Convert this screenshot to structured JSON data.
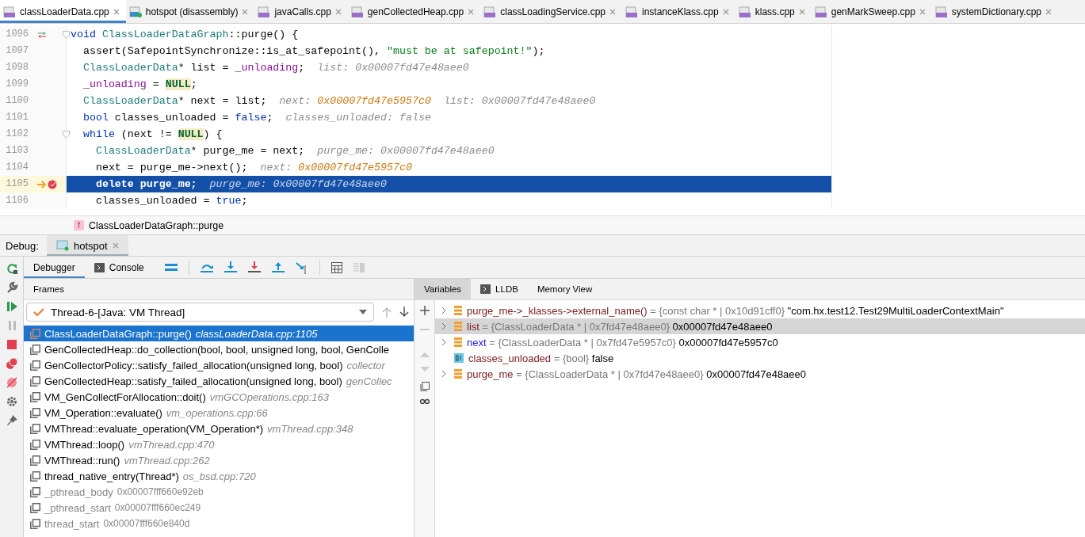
{
  "tabs": [
    {
      "label": "classLoaderData.cpp",
      "kind": "cpp",
      "selected": true
    },
    {
      "label": "hotspot (disassembly)",
      "kind": "disasm",
      "selected": false
    },
    {
      "label": "javaCalls.cpp",
      "kind": "cpp",
      "selected": false
    },
    {
      "label": "genCollectedHeap.cpp",
      "kind": "cpp",
      "selected": false
    },
    {
      "label": "classLoadingService.cpp",
      "kind": "cpp",
      "selected": false
    },
    {
      "label": "instanceKlass.cpp",
      "kind": "cpp",
      "selected": false
    },
    {
      "label": "klass.cpp",
      "kind": "cpp",
      "selected": false
    },
    {
      "label": "genMarkSweep.cpp",
      "kind": "cpp",
      "selected": false
    },
    {
      "label": "systemDictionary.cpp",
      "kind": "cpp",
      "selected": false
    }
  ],
  "editor": {
    "lines": [
      {
        "number": "1096",
        "kind": "override",
        "current": false,
        "foldable": true,
        "tokens": [
          {
            "t": "void ",
            "kind": "kw"
          },
          {
            "t": "ClassLoaderDataGraph",
            "kind": "type"
          },
          {
            "t": "::purge() {"
          }
        ]
      },
      {
        "number": "1097",
        "kind": "plain",
        "current": false,
        "foldable": false,
        "tokens": [
          {
            "t": "  assert(SafepointSynchronize::is_at_safepoint(), "
          },
          {
            "t": "\"must be at safepoint!\"",
            "kind": "str"
          },
          {
            "t": ");"
          }
        ]
      },
      {
        "number": "1098",
        "kind": "plain",
        "current": false,
        "foldable": false,
        "tokens": [
          {
            "t": "  ClassLoaderData",
            "kind": "type"
          },
          {
            "t": "* list = "
          },
          {
            "t": "_unloading",
            "kind": "glob"
          },
          {
            "t": ";"
          }
        ],
        "hints": [
          {
            "name": "list: ",
            "value": "0x00007fd47e48aee0",
            "changed": false
          }
        ]
      },
      {
        "number": "1099",
        "kind": "plain",
        "current": false,
        "foldable": false,
        "tokens": [
          {
            "t": "  _unloading",
            "kind": "glob"
          },
          {
            "t": " = "
          },
          {
            "t": "NULL",
            "kind": "macro"
          },
          {
            "t": ";"
          }
        ]
      },
      {
        "number": "1100",
        "kind": "plain",
        "current": false,
        "foldable": false,
        "tokens": [
          {
            "t": "  ClassLoaderData",
            "kind": "type"
          },
          {
            "t": "* next = list;"
          }
        ],
        "hints": [
          {
            "name": "next: ",
            "value": "0x00007fd47e5957c0",
            "changed": true
          },
          {
            "name": "list: ",
            "value": "0x00007fd47e48aee0",
            "changed": false
          }
        ]
      },
      {
        "number": "1101",
        "kind": "plain",
        "current": false,
        "foldable": false,
        "tokens": [
          {
            "t": "  bool",
            "kind": "kw"
          },
          {
            "t": " classes_unloaded = "
          },
          {
            "t": "false",
            "kind": "kw"
          },
          {
            "t": ";"
          }
        ],
        "hints": [
          {
            "name": "classes_unloaded: ",
            "value": "false",
            "changed": false
          }
        ]
      },
      {
        "number": "1102",
        "kind": "plain",
        "current": false,
        "foldable": true,
        "tokens": [
          {
            "t": "  while",
            "kind": "kw"
          },
          {
            "t": " (next != "
          },
          {
            "t": "NULL",
            "kind": "macro"
          },
          {
            "t": ") {"
          }
        ]
      },
      {
        "number": "1103",
        "kind": "plain",
        "current": false,
        "foldable": false,
        "tokens": [
          {
            "t": "    ClassLoaderData",
            "kind": "type"
          },
          {
            "t": "* purge_me = next;"
          }
        ],
        "hints": [
          {
            "name": "purge_me: ",
            "value": "0x00007fd47e48aee0",
            "changed": false
          }
        ]
      },
      {
        "number": "1104",
        "kind": "plain",
        "current": false,
        "foldable": false,
        "tokens": [
          {
            "t": "    next = purge_me->next();"
          }
        ],
        "hints": [
          {
            "name": "next: ",
            "value": "0x00007fd47e5957c0",
            "changed": true
          }
        ]
      },
      {
        "number": "1105",
        "kind": "breakpoint",
        "current": true,
        "foldable": false,
        "tokens": [
          {
            "t": "    delete",
            "kind": "kw"
          },
          {
            "t": " purge_me;"
          }
        ],
        "hints": [
          {
            "name": "purge_me: ",
            "value": "0x00007fd47e48aee0",
            "changed": false
          }
        ]
      },
      {
        "number": "1106",
        "kind": "plain",
        "current": false,
        "foldable": false,
        "tokens": [
          {
            "t": "    classes_unloaded = "
          },
          {
            "t": "true",
            "kind": "kw"
          },
          {
            "t": ";"
          }
        ]
      }
    ],
    "breadcrumb": {
      "badge": "f",
      "text": "ClassLoaderDataGraph::purge"
    }
  },
  "debug": {
    "label": "Debug:",
    "session_tab": {
      "label": "hotspot",
      "selected": true
    },
    "tabs": [
      {
        "label": "Debugger",
        "kind": "plain",
        "selected": true
      },
      {
        "label": "Console",
        "kind": "console",
        "selected": false
      }
    ],
    "frames": {
      "title": "Frames",
      "thread": "Thread-6-[Java: VM Thread]",
      "items": [
        {
          "function": "ClassLoaderDataGraph::purge()",
          "location": "classLoaderData.cpp:1105",
          "kind": "source",
          "selected": true
        },
        {
          "function": "GenCollectedHeap::do_collection(bool, bool, unsigned long, bool, GenColle",
          "kind": "source",
          "selected": false
        },
        {
          "function": "GenCollectorPolicy::satisfy_failed_allocation(unsigned long, bool)",
          "location": "collector",
          "kind": "source",
          "selected": false
        },
        {
          "function": "GenCollectedHeap::satisfy_failed_allocation(unsigned long, bool)",
          "location": "genCollec",
          "kind": "source",
          "selected": false
        },
        {
          "function": "VM_GenCollectForAllocation::doit()",
          "location": "vmGCOperations.cpp:163",
          "kind": "source",
          "selected": false
        },
        {
          "function": "VM_Operation::evaluate()",
          "location": "vm_operations.cpp:66",
          "kind": "source",
          "selected": false
        },
        {
          "function": "VMThread::evaluate_operation(VM_Operation*)",
          "location": "vmThread.cpp:348",
          "kind": "source",
          "selected": false
        },
        {
          "function": "VMThread::loop()",
          "location": "vmThread.cpp:470",
          "kind": "source",
          "selected": false
        },
        {
          "function": "VMThread::run()",
          "location": "vmThread.cpp:262",
          "kind": "source",
          "selected": false
        },
        {
          "function": "thread_native_entry(Thread*)",
          "location": "os_bsd.cpp:720",
          "kind": "source",
          "selected": false
        },
        {
          "function": "_pthread_body",
          "location": "0x00007fff660e92eb",
          "kind": "native",
          "selected": false
        },
        {
          "function": "_pthread_start",
          "location": "0x00007fff660ec249",
          "kind": "native",
          "selected": false
        },
        {
          "function": "thread_start",
          "location": "0x00007fff660e840d",
          "kind": "native",
          "selected": false
        }
      ]
    },
    "variables": {
      "tabs": [
        {
          "label": "Variables",
          "kind": "plain",
          "selected": true
        },
        {
          "label": "LLDB",
          "kind": "console",
          "selected": false
        },
        {
          "label": "Memory View",
          "kind": "plain",
          "selected": false
        }
      ],
      "items": [
        {
          "name": "purge_me->_klasses->external_name()",
          "type": " = {const char * | 0x10d91cff0}",
          "value": "\"com.hx.test12.Test29MultiLoaderContextMain\"",
          "kind": "object",
          "expandable": true,
          "changed": false,
          "selected": false
        },
        {
          "name": "list",
          "type": " = {ClassLoaderData * | 0x7fd47e48aee0}",
          "value": "0x00007fd47e48aee0",
          "kind": "object",
          "expandable": true,
          "changed": false,
          "selected": true
        },
        {
          "name": "next",
          "type": " = {ClassLoaderData * | 0x7fd47e5957c0}",
          "value": "0x00007fd47e5957c0",
          "kind": "object",
          "expandable": true,
          "changed": true,
          "selected": false
        },
        {
          "name": "classes_unloaded",
          "type": " = {bool}",
          "value": "false",
          "kind": "primitive",
          "expandable": false,
          "changed": false,
          "selected": false
        },
        {
          "name": "purge_me",
          "type": " = {ClassLoaderData * | 0x7fd47e48aee0}",
          "value": "0x00007fd47e48aee0",
          "kind": "object",
          "expandable": true,
          "changed": false,
          "selected": false
        }
      ]
    }
  }
}
